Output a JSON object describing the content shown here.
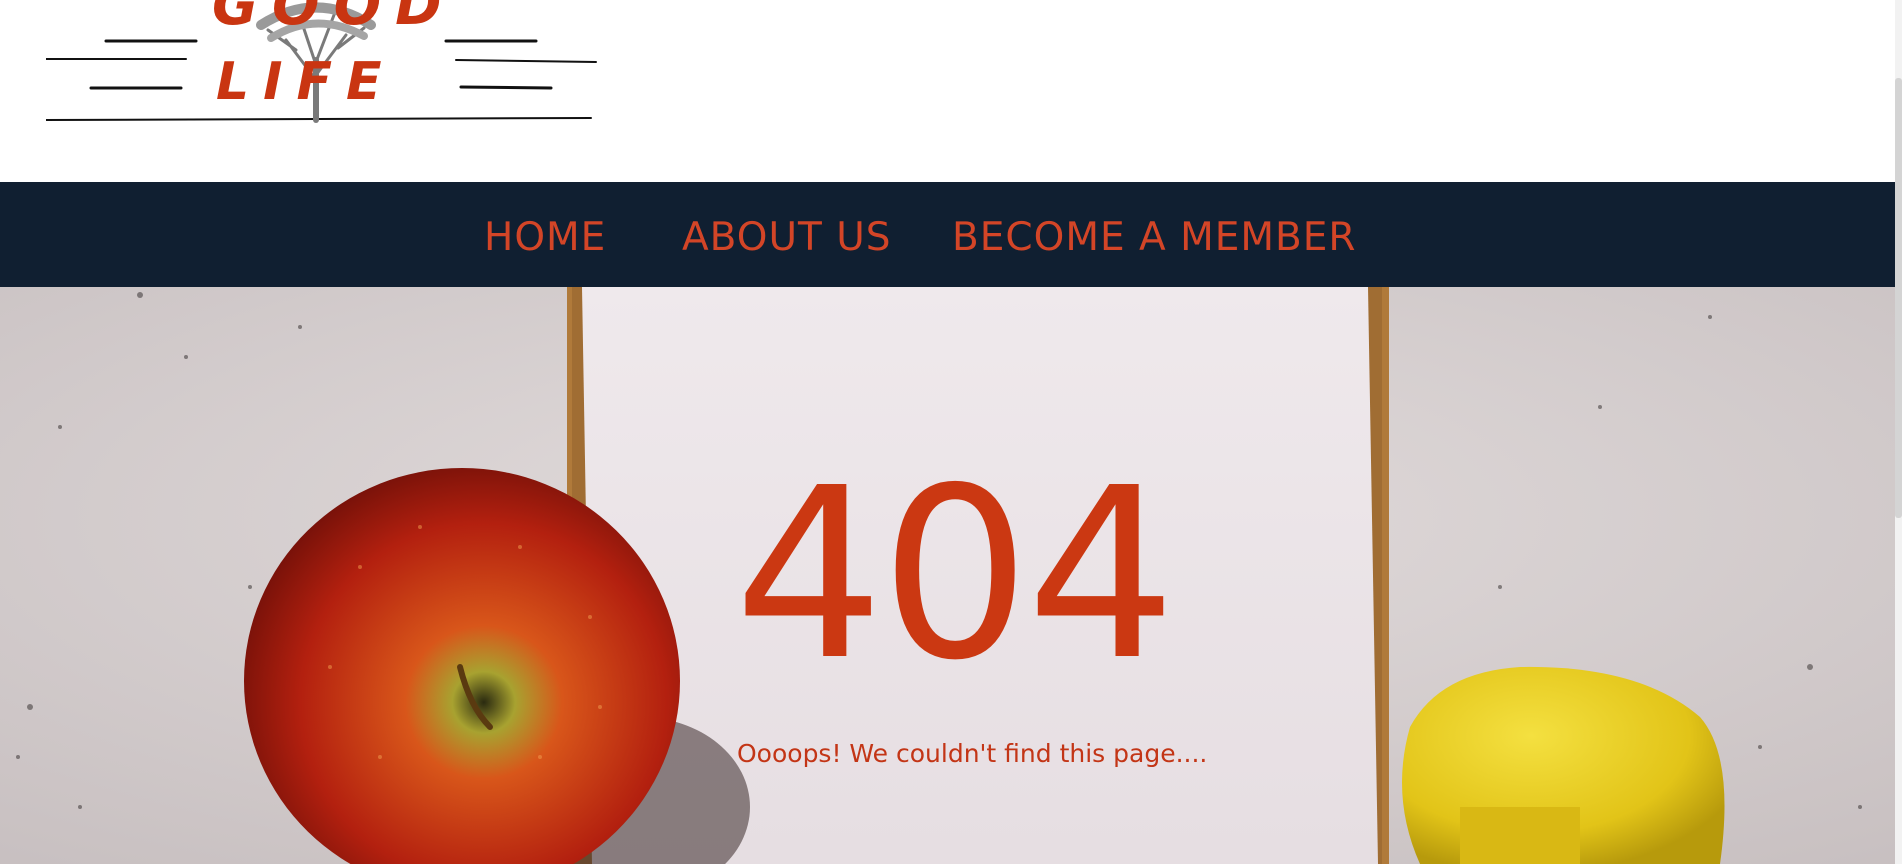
{
  "brand": {
    "logo_text_top": "GOOD",
    "logo_text_bottom": "LIFE"
  },
  "nav": {
    "items": [
      {
        "label": "HOME"
      },
      {
        "label": "ABOUT US"
      },
      {
        "label": "BECOME A MEMBER"
      }
    ]
  },
  "error": {
    "code": "404",
    "message": "Oooops! We couldn't find this page...."
  },
  "colors": {
    "accent": "#cb3812",
    "navbar_bg": "#101f31",
    "header_bg": "#ffffff"
  },
  "icons": {
    "logo_tree": "tree-icon"
  }
}
